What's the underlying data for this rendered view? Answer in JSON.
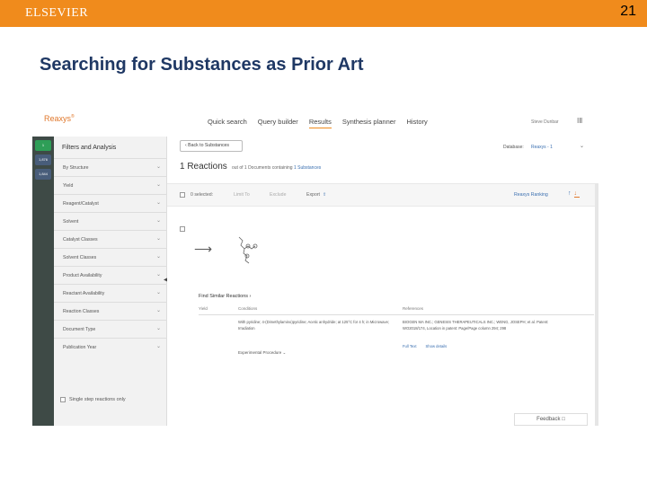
{
  "slide": {
    "brand": "ELSEVIER",
    "number": "21",
    "title": "Searching for Substances as Prior Art"
  },
  "app": {
    "logo": "Reaxys",
    "logo_sup": "®",
    "nav": [
      "Quick search",
      "Query builder",
      "Results",
      "Synthesis planner",
      "History"
    ],
    "active_nav": "Results",
    "user": "Steve Dunbar",
    "help_icon": "ⅠⅡ"
  },
  "rail": {
    "items": [
      "1",
      "1,876",
      "1,844"
    ]
  },
  "filters": {
    "title": "Filters and Analysis",
    "items": [
      "By Structure",
      "Yield",
      "Reagent/Catalyst",
      "Solvent",
      "Catalyst Classes",
      "Solvent Classes",
      "Product Availability",
      "Reactant Availability",
      "Reaction Classes",
      "Document Type",
      "Publication Year"
    ],
    "single_step": "Single step reactions only"
  },
  "main": {
    "back_button": "Back to Substances",
    "database_label": "Database:",
    "database_value": "Reaxys - 1",
    "result_count": "1 Reactions",
    "result_sub_prefix": "out of 1 Documents containing",
    "result_sub_link": "1 Substances",
    "toolbar": {
      "selected": "0 selected:",
      "limit_to": "Limit To",
      "exclude": "Exclude",
      "export": "Export",
      "sort": "Reaxys Ranking"
    },
    "similar_reactions": "Find Similar Reactions",
    "columns": [
      "Yield",
      "Conditions",
      "References"
    ],
    "conditions_text": "With pyridine; 4-(Dimethylamino)pyridine; Acetic anhydride; at 125°C for 4 h; in Microwave; Irradiation",
    "references_text": "BIOGEN MA INC.; GENESIS THERAPEUTICALS INC.; WENG, JOSEPH; et al. Patent: WO2018/174, Location in patent: Page/Page column 294; 298",
    "ref_links": [
      "Full Text",
      "Show details"
    ],
    "experimental": "Experimental Procedure"
  },
  "feedback": "Feedback"
}
